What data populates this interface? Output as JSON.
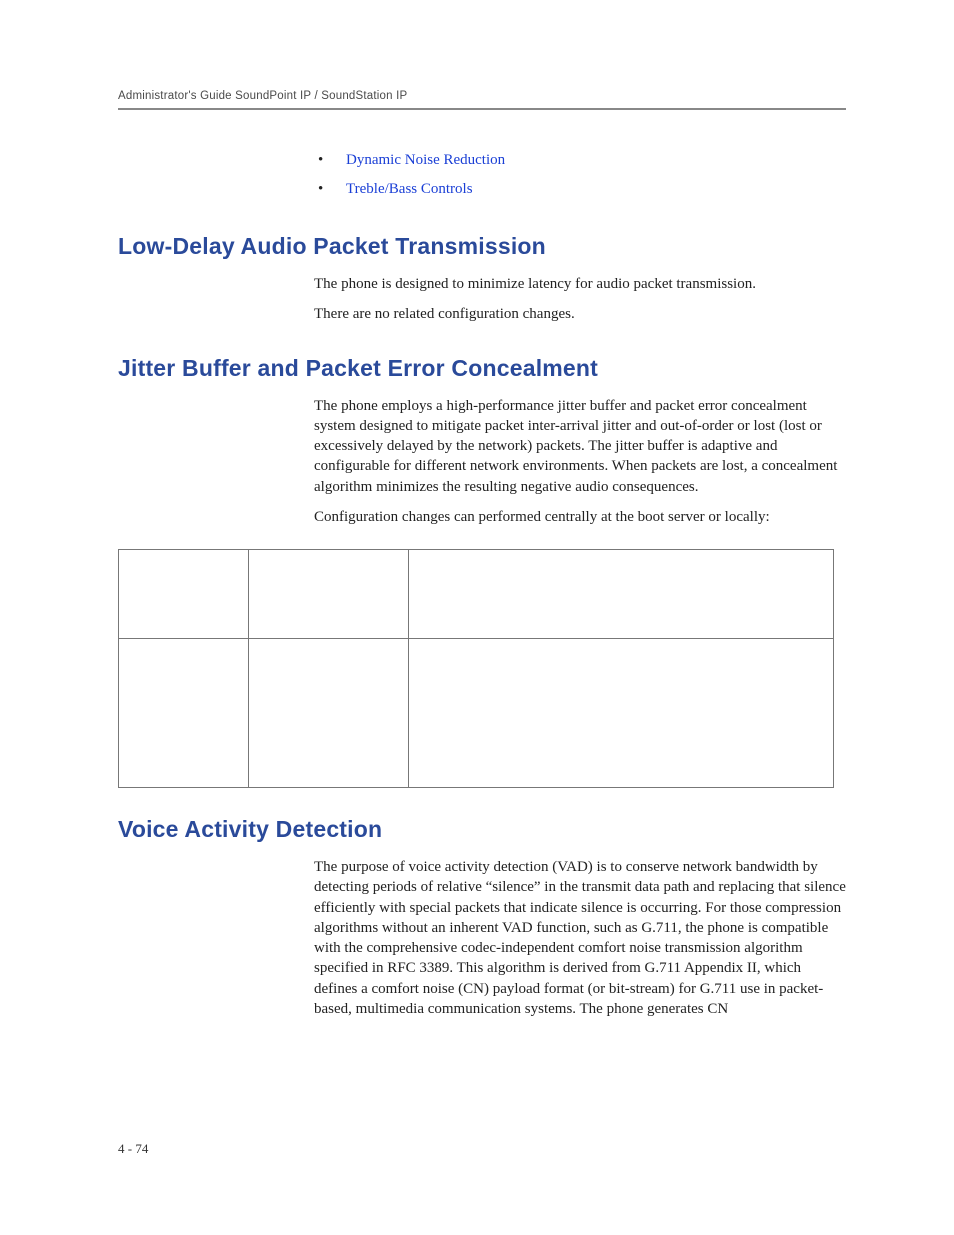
{
  "header": {
    "running_head": "Administrator's Guide SoundPoint IP / SoundStation IP"
  },
  "top_bullets": {
    "item1": "Dynamic Noise Reduction",
    "item2": "Treble/Bass Controls"
  },
  "section1": {
    "heading": "Low-Delay Audio Packet Transmission",
    "p1": "The phone is designed to minimize latency for audio packet transmission.",
    "p2": "There are no related configuration changes."
  },
  "section2": {
    "heading": "Jitter Buffer and Packet Error Concealment",
    "p1": "The phone employs a high-performance jitter buffer and packet error concealment system designed to mitigate packet inter-arrival jitter and out-of-order or lost (lost or excessively delayed by the network) packets. The jitter buffer is adaptive and configurable for different network environments. When packets are lost, a concealment algorithm minimizes the resulting negative audio consequences.",
    "p2": "Configuration changes can performed centrally at the boot server or locally:"
  },
  "section3": {
    "heading": "Voice Activity Detection",
    "p1": "The purpose of voice activity detection (VAD) is to conserve network bandwidth by detecting periods of relative “silence” in the transmit data path and replacing that silence efficiently with special packets that indicate silence is occurring. For those compression algorithms without an inherent VAD function, such as G.711, the phone is compatible with the comprehensive codec-independent comfort noise transmission algorithm specified in RFC 3389. This algorithm is derived from G.711 Appendix II, which defines a comfort noise (CN) payload format (or bit-stream) for G.711 use in packet-based, multimedia communication systems. The phone generates CN"
  },
  "footer": {
    "page_number": "4 - 74"
  }
}
